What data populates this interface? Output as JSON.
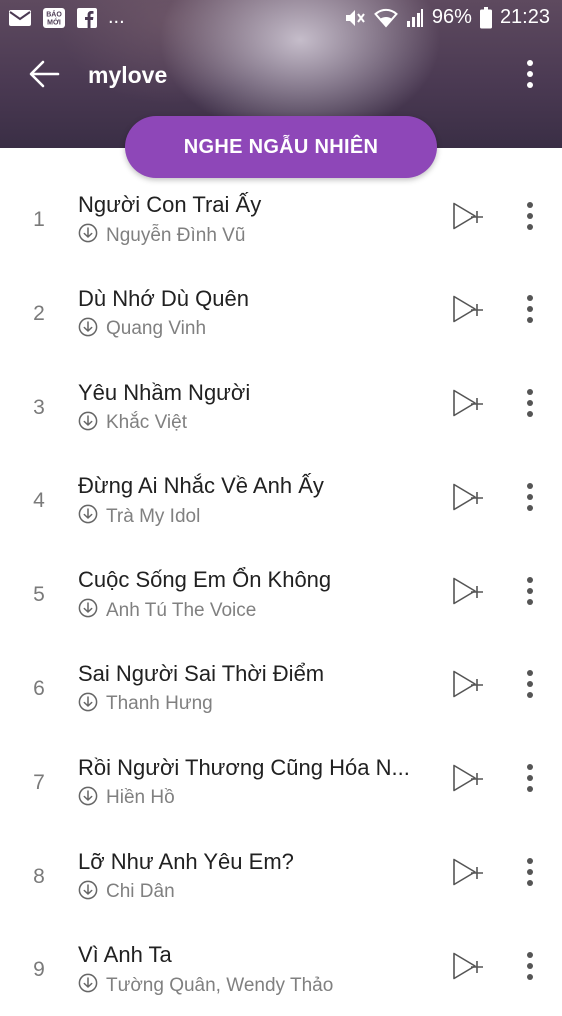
{
  "status_bar": {
    "left_icons": [
      "mail-icon",
      "baomoi-app-icon",
      "facebook-icon",
      "more-notifications-icon"
    ],
    "baomoi_label_1": "BÁO",
    "baomoi_label_2": "MỚI",
    "more_notifications": "...",
    "battery_percent": "96%",
    "time": "21:23"
  },
  "app_bar": {
    "title": "mylove"
  },
  "shuffle_button_label": "NGHE NGẪU NHIÊN",
  "colors": {
    "accent": "#8e47b8",
    "header_dark": "#3a2e45",
    "title_text": "#212121",
    "secondary_text": "#808080"
  },
  "songs": [
    {
      "index": "1",
      "title": "Người Con Trai Ấy",
      "artist": "Nguyễn Đình Vũ"
    },
    {
      "index": "2",
      "title": "Dù Nhớ Dù Quên",
      "artist": "Quang Vinh"
    },
    {
      "index": "3",
      "title": "Yêu Nhầm Người",
      "artist": "Khắc Việt"
    },
    {
      "index": "4",
      "title": "Đừng Ai Nhắc Về Anh Ấy",
      "artist": "Trà My Idol"
    },
    {
      "index": "5",
      "title": "Cuộc Sống Em Ổn Không",
      "artist": "Anh Tú The Voice"
    },
    {
      "index": "6",
      "title": "Sai Người Sai Thời Điểm",
      "artist": "Thanh Hưng"
    },
    {
      "index": "7",
      "title": "Rồi Người Thương Cũng Hóa N...",
      "artist": "Hiền Hồ"
    },
    {
      "index": "8",
      "title": "Lỡ Như Anh Yêu Em?",
      "artist": "Chi Dân"
    },
    {
      "index": "9",
      "title": "Vì Anh Ta",
      "artist": "Tường Quân, Wendy Thảo"
    }
  ]
}
